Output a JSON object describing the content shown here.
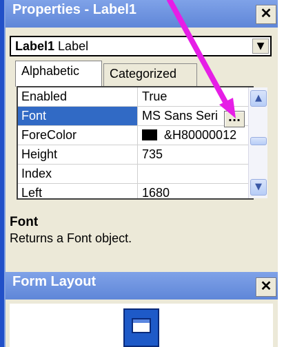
{
  "properties_window": {
    "title": "Properties - Label1",
    "close_glyph": "✕",
    "object_combo": {
      "name": "Label1",
      "type": "Label",
      "dropdown_glyph": "▼"
    },
    "tabs": [
      {
        "label": "Alphabetic",
        "active": true
      },
      {
        "label": "Categorized",
        "active": false
      }
    ],
    "grid_rows": [
      {
        "name": "Enabled",
        "value": "True"
      },
      {
        "name": "Font",
        "value": "MS Sans Seri",
        "selected": true
      },
      {
        "name": "ForeColor",
        "value": "&H80000012"
      },
      {
        "name": "Height",
        "value": "735"
      },
      {
        "name": "Index",
        "value": ""
      },
      {
        "name": "Left",
        "value": "1680"
      }
    ],
    "ellipsis_label": "...",
    "description": {
      "title": "Font",
      "text": "Returns a Font object."
    }
  },
  "form_layout_window": {
    "title": "Form Layout",
    "close_glyph": "✕"
  },
  "colors": {
    "titlebar": "#6b8fdd",
    "selection": "#316ac5",
    "annotation_arrow": "#e61ee6",
    "panel": "#ece9d8"
  },
  "icons": {
    "close": "close-icon",
    "dropdown": "chevron-down-icon",
    "scroll_up": "chevron-up-icon",
    "scroll_down": "chevron-down-icon",
    "form_layout": "monitor-icon",
    "forecolor_swatch": "color-swatch-icon"
  }
}
